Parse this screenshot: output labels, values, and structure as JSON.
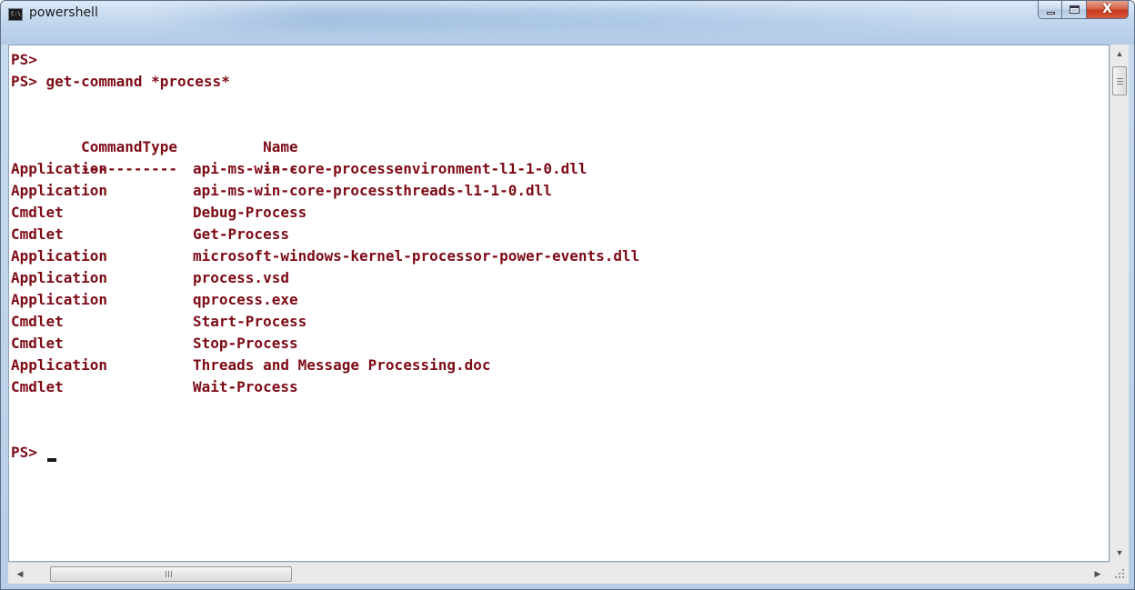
{
  "window": {
    "title": "powershell",
    "app_icon_glyph": "C:\\",
    "icon": "powershell-console-icon",
    "minimize_icon": "minimize-icon",
    "maximize_icon": "maximize-icon",
    "close_icon": "close-icon",
    "close_glyph": "X"
  },
  "colors": {
    "console_text": "#7d0b16",
    "console_background": "#ffffff",
    "close_button": "#c7391e"
  },
  "console": {
    "prompt_1": "PS>",
    "command_line": "PS> get-command *process*",
    "header": {
      "type": "CommandType",
      "name": "Name"
    },
    "separator": {
      "type": "-----------",
      "name": "----"
    },
    "rows": [
      {
        "type": "Application",
        "name": "api-ms-win-core-processenvironment-l1-1-0.dll"
      },
      {
        "type": "Application",
        "name": "api-ms-win-core-processthreads-l1-1-0.dll"
      },
      {
        "type": "Cmdlet",
        "name": "Debug-Process"
      },
      {
        "type": "Cmdlet",
        "name": "Get-Process"
      },
      {
        "type": "Application",
        "name": "microsoft-windows-kernel-processor-power-events.dll"
      },
      {
        "type": "Application",
        "name": "process.vsd"
      },
      {
        "type": "Application",
        "name": "qprocess.exe"
      },
      {
        "type": "Cmdlet",
        "name": "Start-Process"
      },
      {
        "type": "Cmdlet",
        "name": "Stop-Process"
      },
      {
        "type": "Application",
        "name": "Threads and Message Processing.doc"
      },
      {
        "type": "Cmdlet",
        "name": "Wait-Process"
      }
    ],
    "final_prompt": "PS> "
  },
  "scrollbars": {
    "up_arrow": "▲",
    "down_arrow": "▼",
    "left_arrow": "◀",
    "right_arrow": "▶",
    "vertical_position": 0,
    "horizontal_position": 0
  }
}
